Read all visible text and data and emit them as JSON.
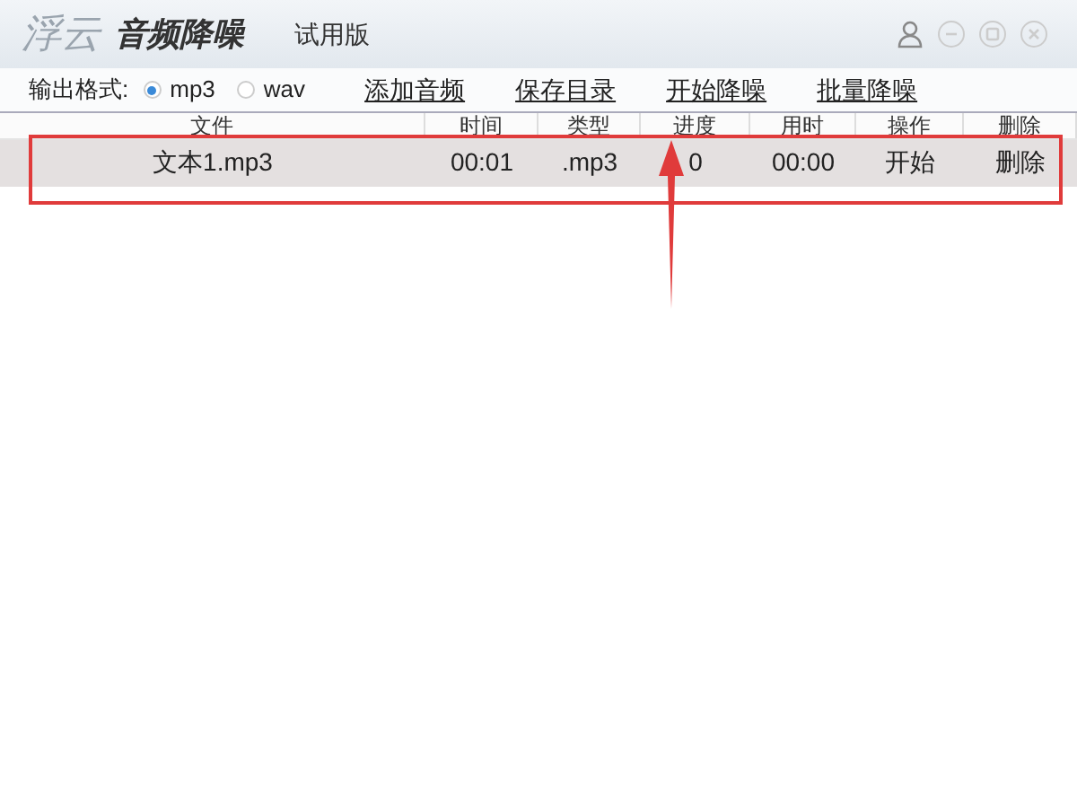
{
  "window": {
    "logo": "浮云",
    "app_name": "音频降噪",
    "edition": "试用版"
  },
  "toolbar": {
    "format_label": "输出格式:",
    "formats": [
      {
        "label": "mp3",
        "selected": true
      },
      {
        "label": "wav",
        "selected": false
      }
    ],
    "links": [
      "添加音频",
      "保存目录",
      "开始降噪",
      "批量降噪"
    ]
  },
  "table": {
    "columns": [
      "文件",
      "时间",
      "类型",
      "进度",
      "用时",
      "操作",
      "删除"
    ],
    "rows": [
      {
        "selected": true,
        "cells": [
          "文本1.mp3",
          "00:01",
          ".mp3",
          "0",
          "00:00",
          "开始",
          "删除"
        ]
      }
    ]
  }
}
